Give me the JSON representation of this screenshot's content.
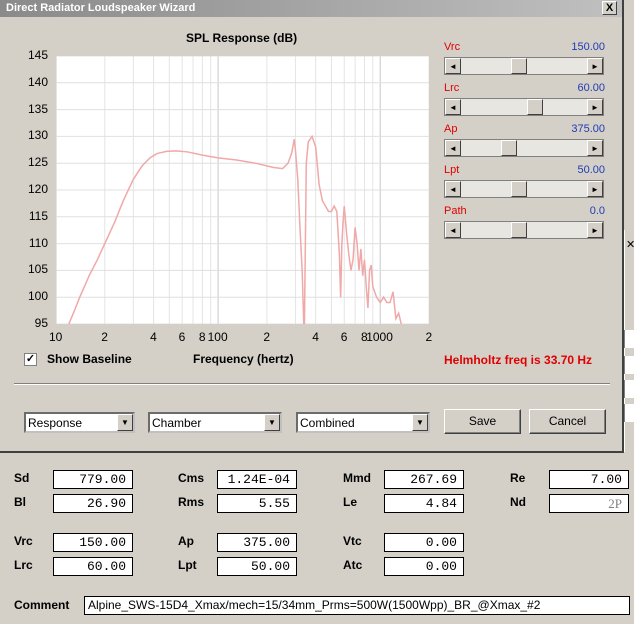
{
  "window": {
    "title": "Direct Radiator Loudspeaker Wizard",
    "close_glyph": "X"
  },
  "chart_data": {
    "type": "line",
    "title": "SPL Response (dB)",
    "xlabel": "Frequency (hertz)",
    "ylabel": "",
    "xscale": "log",
    "xlim": [
      10,
      2000
    ],
    "ylim": [
      95,
      145
    ],
    "y_ticks": [
      "145",
      "140",
      "135",
      "130",
      "125",
      "120",
      "115",
      "110",
      "105",
      "100",
      "95"
    ],
    "x_ticks": [
      "10",
      "2",
      "4",
      "6",
      "8",
      "100",
      "2",
      "4",
      "6",
      "8",
      "1000",
      "2"
    ],
    "grid": true,
    "line_color": "#f0a8a8",
    "series": [
      {
        "x": [
          10,
          11,
          12,
          13,
          14,
          15,
          16,
          18,
          20,
          23,
          26,
          30,
          34,
          38,
          42,
          48,
          55,
          65,
          80,
          100,
          130,
          170,
          220,
          250,
          270,
          285,
          295,
          300,
          310,
          320,
          330,
          340,
          350,
          360,
          380,
          400,
          420,
          440,
          460,
          480,
          500,
          520,
          540,
          560,
          570,
          580,
          590,
          600,
          620,
          640,
          660,
          680,
          700,
          720,
          740,
          760,
          780,
          800,
          820,
          840,
          860,
          880,
          900,
          950,
          1000,
          1050,
          1100,
          1150,
          1200,
          1250,
          1300,
          1400,
          1500
        ],
        "y": [
          90,
          92.5,
          95,
          97.5,
          100,
          102,
          104,
          107,
          110,
          114,
          118,
          122,
          124.5,
          126,
          126.8,
          127.2,
          127.3,
          127.1,
          126.5,
          126,
          125.6,
          125,
          124.2,
          124,
          125,
          127,
          129.5,
          127.5,
          122,
          113,
          105,
          92,
          125,
          129,
          130,
          128,
          121,
          118,
          117,
          116,
          116,
          117,
          116,
          108,
          100,
          110,
          114,
          117,
          112,
          108,
          105,
          107,
          113,
          110,
          105,
          109,
          104,
          107,
          102,
          98,
          105,
          106,
          102,
          100,
          99,
          100,
          99,
          99,
          101,
          96,
          97,
          93,
          90
        ]
      }
    ]
  },
  "params": [
    {
      "label": "Vrc",
      "value": "150.00",
      "thumb": 0.45
    },
    {
      "label": "Lrc",
      "value": "60.00",
      "thumb": 0.6
    },
    {
      "label": "Ap",
      "value": "375.00",
      "thumb": 0.36
    },
    {
      "label": "Lpt",
      "value": "50.00",
      "thumb": 0.45
    },
    {
      "label": "Path",
      "value": "0.0",
      "thumb": 0.45
    }
  ],
  "show_baseline": {
    "label": "Show Baseline",
    "checked": true,
    "check_glyph": "✓"
  },
  "helmholtz": "Helmholtz freq is 33.70 Hz",
  "helmholtz_color": "#e00000",
  "combos": {
    "response": "Response",
    "chamber": "Chamber",
    "combined": "Combined"
  },
  "buttons": {
    "save": "Save",
    "cancel": "Cancel"
  },
  "fields": {
    "sd": {
      "label": "Sd",
      "value": "779.00"
    },
    "cms": {
      "label": "Cms",
      "value": "1.24E-04"
    },
    "mmd": {
      "label": "Mmd",
      "value": "267.69"
    },
    "re": {
      "label": "Re",
      "value": "7.00"
    },
    "bl": {
      "label": "Bl",
      "value": "26.90"
    },
    "rms": {
      "label": "Rms",
      "value": "5.55"
    },
    "le": {
      "label": "Le",
      "value": "4.84"
    },
    "nd": {
      "label": "Nd",
      "value": "2P"
    },
    "vrc": {
      "label": "Vrc",
      "value": "150.00"
    },
    "ap": {
      "label": "Ap",
      "value": "375.00"
    },
    "vtc": {
      "label": "Vtc",
      "value": "0.00"
    },
    "lrc": {
      "label": "Lrc",
      "value": "60.00"
    },
    "lpt": {
      "label": "Lpt",
      "value": "50.00"
    },
    "atc": {
      "label": "Atc",
      "value": "0.00"
    }
  },
  "comment": {
    "label": "Comment",
    "value": "Alpine_SWS-15D4_Xmax/mech=15/34mm_Prms=500W(1500Wpp)_BR_@Xmax_#2"
  },
  "icons": {
    "scroll_left": "◄",
    "scroll_right": "►",
    "combo_arrow": "▼"
  }
}
